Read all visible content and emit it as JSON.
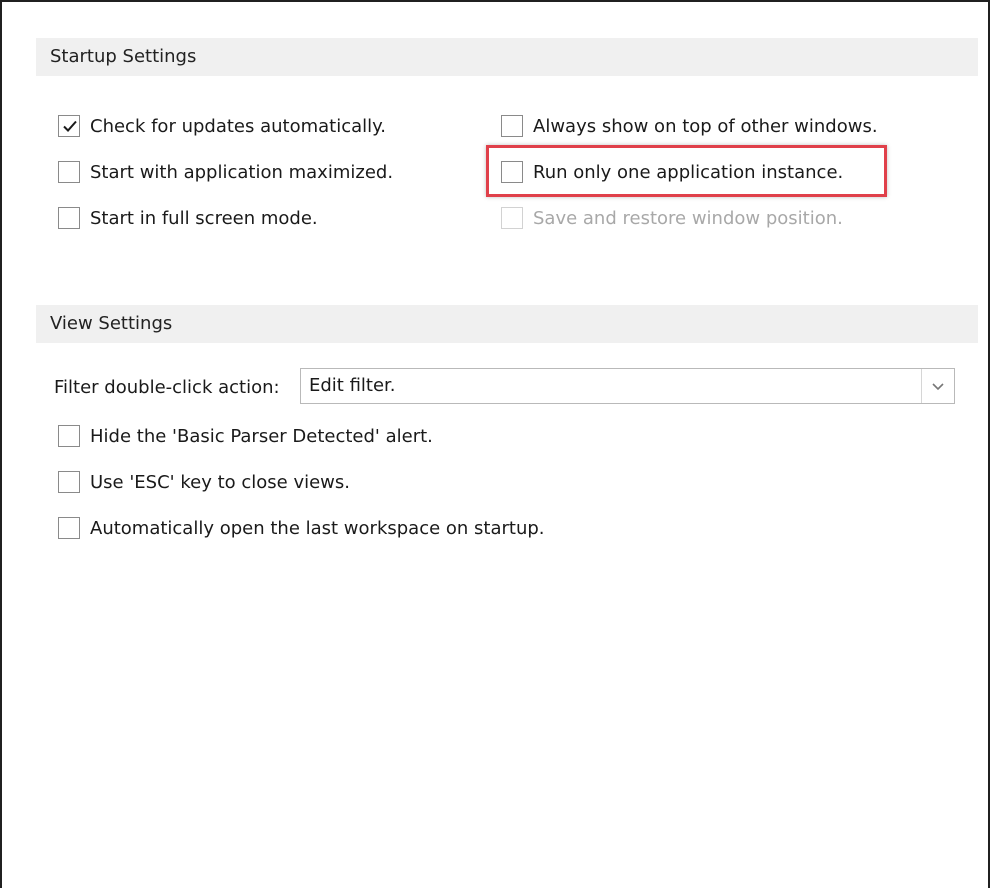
{
  "startup": {
    "header": "Startup Settings",
    "options": [
      {
        "label": "Check for updates automatically.",
        "checked": true,
        "disabled": false
      },
      {
        "label": "Start with application maximized.",
        "checked": false,
        "disabled": false
      },
      {
        "label": "Start in full screen mode.",
        "checked": false,
        "disabled": false
      },
      {
        "label": "Always show on top of other windows.",
        "checked": false,
        "disabled": false
      },
      {
        "label": "Run only one application instance.",
        "checked": false,
        "disabled": false
      },
      {
        "label": "Save and restore window position.",
        "checked": false,
        "disabled": true
      }
    ]
  },
  "view": {
    "header": "View Settings",
    "filter_label": "Filter double-click action:",
    "filter_value": "Edit filter.",
    "options": [
      {
        "label": "Hide the 'Basic Parser Detected' alert.",
        "checked": false
      },
      {
        "label": "Use 'ESC' key to close views.",
        "checked": false
      },
      {
        "label": "Automatically open the last workspace on startup.",
        "checked": false
      }
    ]
  },
  "colors": {
    "highlight": "#e0404a",
    "section_bg": "#f0f0f0"
  },
  "icons": {
    "check": "checkmark-icon",
    "dropdown": "chevron-down-icon"
  }
}
